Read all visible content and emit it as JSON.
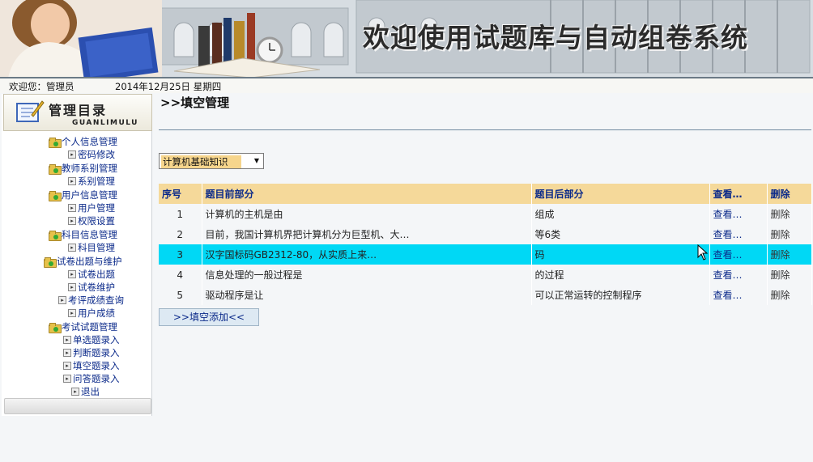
{
  "banner": {
    "title": "欢迎使用试题库与自动组卷系统"
  },
  "status": {
    "welcome": "欢迎您：管理员",
    "date": "2014年12月25日  星期四"
  },
  "sidebar": {
    "header_title": "管理目录",
    "header_sub": "GUANLIMULU",
    "items": [
      {
        "label": "个人信息管理",
        "type": "folder"
      },
      {
        "label": "密码修改",
        "type": "leaf"
      },
      {
        "label": "教师系别管理",
        "type": "folder"
      },
      {
        "label": "系别管理",
        "type": "leaf"
      },
      {
        "label": "用户信息管理",
        "type": "folder"
      },
      {
        "label": "用户管理",
        "type": "leaf"
      },
      {
        "label": "权限设置",
        "type": "leaf"
      },
      {
        "label": "科目信息管理",
        "type": "folder"
      },
      {
        "label": "科目管理",
        "type": "leaf"
      },
      {
        "label": "试卷出题与维护",
        "type": "folder"
      },
      {
        "label": "试卷出题",
        "type": "leaf"
      },
      {
        "label": "试卷维护",
        "type": "leaf"
      },
      {
        "label": "考评成绩查询",
        "type": "leaf"
      },
      {
        "label": "用户成绩",
        "type": "leaf"
      },
      {
        "label": "考试试题管理",
        "type": "folder"
      },
      {
        "label": "单选题录入",
        "type": "leaf"
      },
      {
        "label": "判断题录入",
        "type": "leaf"
      },
      {
        "label": "填空题录入",
        "type": "leaf"
      },
      {
        "label": "问答题录入",
        "type": "leaf"
      },
      {
        "label": "退出",
        "type": "leaf"
      }
    ]
  },
  "main": {
    "title": ">>填空管理",
    "category_selected": "计算机基础知识",
    "columns": [
      "序号",
      "题目前部分",
      "题目后部分",
      "查看…",
      "删除"
    ],
    "rows": [
      {
        "seq": "1",
        "front": "计算机的主机是由",
        "back": "组成",
        "view": "查看…",
        "del": "删除"
      },
      {
        "seq": "2",
        "front": "目前，我国计算机界把计算机分为巨型机、大…",
        "back": "等6类",
        "view": "查看…",
        "del": "删除"
      },
      {
        "seq": "3",
        "front": "汉字国标码GB2312-80，从实质上来…",
        "back": "码",
        "view": "查看…",
        "del": "删除"
      },
      {
        "seq": "4",
        "front": "信息处理的一般过程是",
        "back": "的过程",
        "view": "查看…",
        "del": "删除"
      },
      {
        "seq": "5",
        "front": "驱动程序是让",
        "back": "可以正常运转的控制程序",
        "view": "查看…",
        "del": "删除"
      }
    ],
    "selected_row": 3,
    "add_label": ">>填空添加<<"
  },
  "colors": {
    "header_bg": "#f5d99a",
    "selected_row": "#00d8f5",
    "link": "#0b2a8a"
  }
}
